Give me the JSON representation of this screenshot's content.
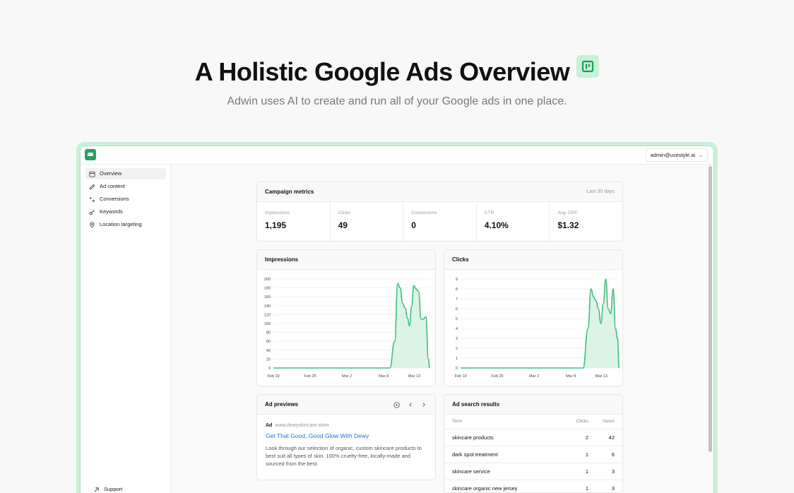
{
  "hero": {
    "title": "A Holistic Google Ads Overview",
    "subtitle": "Adwin uses AI to create and run all of your Google ads in one place."
  },
  "account": {
    "email": "admin@usestyle.ai"
  },
  "sidebar": {
    "items": [
      {
        "label": "Overview",
        "icon": "calendar-icon",
        "active": true
      },
      {
        "label": "Ad content",
        "icon": "pencil-icon"
      },
      {
        "label": "Conversions",
        "icon": "conversion-icon"
      },
      {
        "label": "Keywords",
        "icon": "key-icon"
      },
      {
        "label": "Location targeting",
        "icon": "map-pin-icon"
      }
    ],
    "support": "Support"
  },
  "metrics": {
    "title": "Campaign metrics",
    "period": "Last 30 days",
    "items": [
      {
        "label": "Impressions",
        "value": "1,195"
      },
      {
        "label": "Clicks",
        "value": "49"
      },
      {
        "label": "Conversions",
        "value": "0"
      },
      {
        "label": "CTR",
        "value": "4.10%"
      },
      {
        "label": "Avg. CPC",
        "value": "$1.32"
      }
    ]
  },
  "colors": {
    "accent": "#3fbf7f",
    "accent_fill": "#d8f2e3",
    "brand": "#22a45d",
    "link": "#1a73e8"
  },
  "chart_data": [
    {
      "type": "area",
      "title": "Impressions",
      "x_ticks": [
        "Feb 19",
        "Feb 25",
        "Mar 2",
        "Mar 8",
        "Mar 13"
      ],
      "y_ticks": [
        0,
        20,
        40,
        60,
        80,
        100,
        120,
        140,
        160,
        180,
        200
      ],
      "ylim": [
        0,
        200
      ],
      "x_days": [
        0,
        6,
        12,
        18,
        23
      ],
      "series": [
        {
          "values": [
            [
              0,
              0
            ],
            [
              19,
              0
            ],
            [
              19.8,
              60
            ],
            [
              20.3,
              190
            ],
            [
              20.7,
              180
            ],
            [
              21.1,
              145
            ],
            [
              21.5,
              135
            ],
            [
              21.9,
              112
            ],
            [
              22.2,
              95
            ],
            [
              22.6,
              140
            ],
            [
              22.9,
              185
            ],
            [
              23.3,
              178
            ],
            [
              23.7,
              172
            ],
            [
              24.1,
              110
            ],
            [
              24.5,
              110
            ],
            [
              24.9,
              115
            ],
            [
              25.3,
              20
            ],
            [
              25.5,
              0
            ]
          ]
        }
      ]
    },
    {
      "type": "area",
      "title": "Clicks",
      "x_ticks": [
        "Feb 19",
        "Feb 25",
        "Mar 2",
        "Mar 8",
        "Mar 13"
      ],
      "y_ticks": [
        0,
        1,
        2,
        3,
        4,
        5,
        6,
        7,
        8,
        9
      ],
      "ylim": [
        0,
        9
      ],
      "x_days": [
        0,
        6,
        12,
        18,
        23
      ],
      "series": [
        {
          "values": [
            [
              0,
              0
            ],
            [
              20,
              0
            ],
            [
              20.8,
              4
            ],
            [
              21.3,
              8
            ],
            [
              21.7,
              7.2
            ],
            [
              22.1,
              6.8
            ],
            [
              22.5,
              6
            ],
            [
              22.9,
              4.5
            ],
            [
              23.3,
              6.5
            ],
            [
              23.7,
              9
            ],
            [
              24.1,
              6
            ],
            [
              24.5,
              5.5
            ],
            [
              24.9,
              8
            ],
            [
              25.3,
              4
            ],
            [
              25.6,
              3
            ],
            [
              25.9,
              0
            ]
          ]
        }
      ]
    }
  ],
  "previews": {
    "title": "Ad previews",
    "ad_label": "Ad",
    "url": "www.dewyskincare.store",
    "headline": "Get That Good, Good Glow With Dewy",
    "description": "Look through our selection of organic, custom skincare products to best suit all types of skin. 100% cruelty-free, locally-made and sourced from the best."
  },
  "results": {
    "title": "Ad search results",
    "columns": [
      "Term",
      "Clicks",
      "Views"
    ],
    "rows": [
      [
        "skincare products",
        "2",
        "42"
      ],
      [
        "dark spot treatment",
        "1",
        "6"
      ],
      [
        "skincare service",
        "1",
        "3"
      ],
      [
        "skincare organic new jersey",
        "1",
        "3"
      ]
    ]
  }
}
